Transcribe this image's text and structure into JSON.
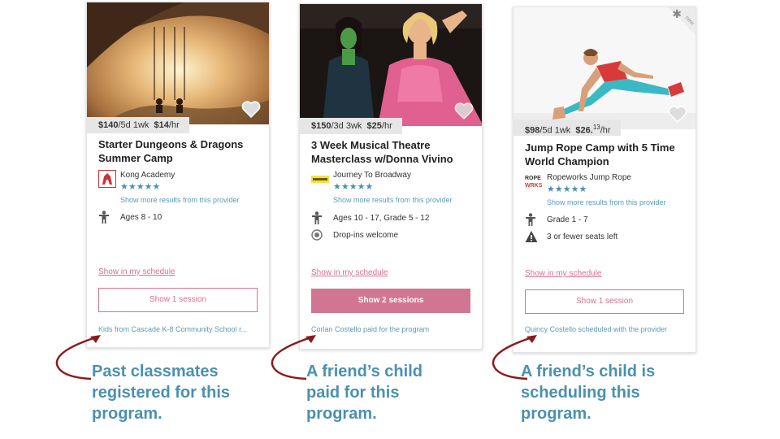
{
  "cards": [
    {
      "price": "$140",
      "price_detail": "/5d 1wk",
      "rate": "$14",
      "rate_cents": "",
      "rate_unit": "/hr",
      "title": "Starter Dungeons & Dragons Summer Camp",
      "provider": "Kong Academy",
      "stars": "★★★★★",
      "more_results": "Show more results from this provider",
      "info": [
        {
          "icon": "child-icon",
          "text": "Ages 8 - 10"
        }
      ],
      "schedule_link": "Show in my schedule",
      "sessions_button": "Show 1 session",
      "social_note": "Kids from Cascade K-8 Community School r..."
    },
    {
      "price": "$150",
      "price_detail": "/3d 3wk",
      "rate": "$25",
      "rate_cents": "",
      "rate_unit": "/hr",
      "title": "3 Week Musical Theatre Masterclass w/Donna Vivino",
      "provider": "Journey To Broadway",
      "stars": "★★★★★",
      "more_results": "Show more results from this provider",
      "info": [
        {
          "icon": "child-icon",
          "text": "Ages 10 - 17, Grade 5 - 12"
        },
        {
          "icon": "target-icon",
          "text": "Drop-ins welcome"
        }
      ],
      "schedule_link": "Show in my schedule",
      "sessions_button": "Show 2 sessions",
      "social_note": "Corlan Costello paid for the program"
    },
    {
      "price": "$98",
      "price_detail": "/5d 1wk",
      "rate": "$26.",
      "rate_cents": "13",
      "rate_unit": "/hr",
      "title": "Jump Rope Camp with 5 Time World Champion",
      "provider": "Ropeworks Jump Rope",
      "stars": "★★★★★",
      "more_results": "Show more results from this provider",
      "info": [
        {
          "icon": "child-icon",
          "text": "Grade 1 - 7"
        },
        {
          "icon": "warning-icon",
          "text": "3 or fewer seats left"
        }
      ],
      "schedule_link": "Show in my schedule",
      "sessions_button": "Show 1 session",
      "social_note": "Quincy Costello scheduled with the provider",
      "badge": "new"
    }
  ],
  "annotations": [
    "Past classmates registered for this program.",
    "A friend’s child paid for this program.",
    "A friend’s child is scheduling this program."
  ],
  "colors": {
    "accent_pink": "#d9708f",
    "link_blue": "#5b9ab8",
    "annotation_blue": "#4a90b0",
    "arrow_red": "#8b1a1a"
  }
}
